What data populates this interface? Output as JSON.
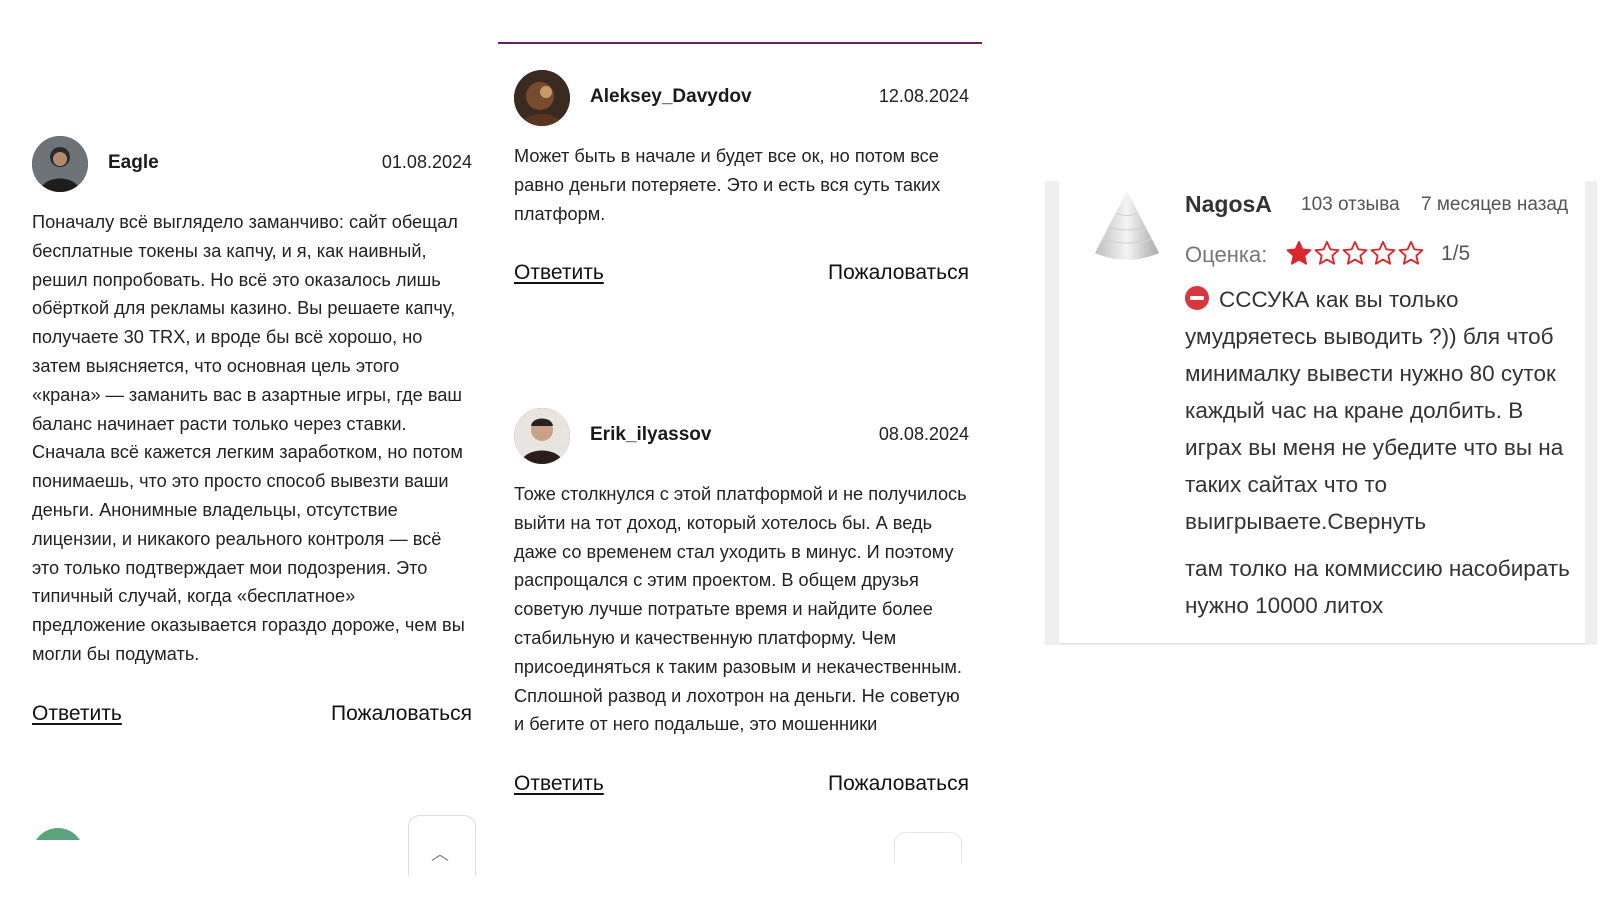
{
  "reviews": [
    {
      "user": "Eagle",
      "date": "01.08.2024",
      "text": "Поначалу всё выглядело заманчиво: сайт обещал бесплатные токены за капчу, и я, как наивный, решил попробовать. Но всё это оказалось лишь обёрткой для рекламы казино. Вы решаете капчу, получаете 30 TRX, и вроде бы всё хорошо, но затем выясняется, что основная цель этого «крана» — заманить вас в азартные игры, где ваш баланс начинает расти только через ставки. Сначала всё кажется легким заработком, но потом понимаешь, что это просто способ вывезти ваши деньги. Анонимные владельцы, отсутствие лицензии, и никакого реального контроля — всё это только подтверждает мои подозрения. Это типичный случай, когда «бесплатное» предложение оказывается гораздо дороже, чем вы могли бы подумать.",
      "reply": "Ответить",
      "complain": "Пожаловаться"
    },
    {
      "user": "Aleksey_Davydov",
      "date": "12.08.2024",
      "text": "Может быть в начале и будет все ок, но потом все равно деньги потеряете. Это и есть вся суть таких платформ.",
      "reply": "Ответить",
      "complain": "Пожаловаться"
    },
    {
      "user": "Erik_ilyassov",
      "date": "08.08.2024",
      "text": "Тоже столкнулся с этой платформой и не получилось выйти на тот доход, который хотелось бы. А ведь даже со временем стал уходить в минус. И поэтому распрощался с этим проектом. В общем друзья советую лучше потратьте время и найдите более стабильную и качественную платформу. Чем присоединяться к таким разовым и некачественным. Сплошной развод и лохотрон на деньги. Не советую и бегите от него подальше, это мошенники",
      "reply": "Ответить",
      "complain": "Пожаловаться"
    }
  ],
  "partial_complain": "Пожаловаться",
  "scroll_top_icon": "chevron-up-icon",
  "card": {
    "user": "NagosA",
    "reviews_count": "103 отзыва",
    "time_ago": "7 месяцев назад",
    "rating_label": "Оценка:",
    "rating_value": "1/5",
    "rating": 1,
    "rating_max": 5,
    "text": "СССУКА как вы только умудряетесь выводить ?)) бля чтоб минималку вывести нужно 80 суток каждый час на кране долбить. В играх вы меня не убедите что вы на таких сайтах что то выигрываете.",
    "collapse": "Свернуть",
    "text_cont": "там толко на коммиссию насобирать нужно 10000 литох"
  },
  "colors": {
    "accent_line": "#6b1f5e",
    "star": "#d9272e",
    "negative_icon": "#d9363e"
  }
}
